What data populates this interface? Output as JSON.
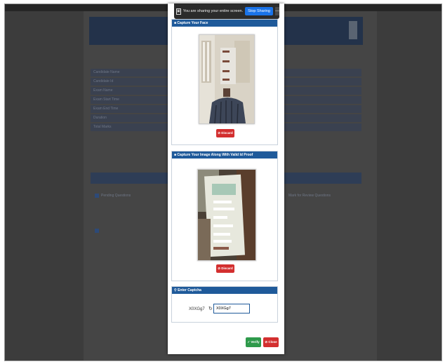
{
  "screen_share": {
    "message": "You are sharing your entire screen.",
    "stop_label": "Stop Sharing",
    "hide_label": "—"
  },
  "background": {
    "rows": [
      {
        "label": "Candidate Name",
        "value": "Candidate Name"
      },
      {
        "label": "Candidate Id",
        "value": "Candidate Id"
      },
      {
        "label": "Exam Name",
        "value": "Exam Name"
      },
      {
        "label": "Exam Start Time",
        "value": "Exam Start Time"
      },
      {
        "label": "Exam End Time",
        "value": "Exam End Time"
      },
      {
        "label": "Duration",
        "value": "Duration"
      },
      {
        "label": "Total Marks",
        "value": "Total Marks"
      }
    ],
    "legend": {
      "pending": "Pending Questions",
      "review": "Mark for Review Questions"
    }
  },
  "modal": {
    "face": {
      "title": "Capture Your Face",
      "discard_label": "Discard"
    },
    "id_proof": {
      "title": "Capture Your Image Along With Valid Id Proof",
      "discard_label": "Discard"
    },
    "captcha": {
      "title": "Enter Captcha",
      "code": "X0XGg7",
      "input_value": "X0XGg7"
    },
    "verify_label": "Verify",
    "close_label": "Close"
  },
  "colors": {
    "panel_header": "#1f5a9a",
    "discard": "#d32f2f",
    "verify": "#2e9a4b",
    "stop_sharing": "#1a73e8"
  }
}
